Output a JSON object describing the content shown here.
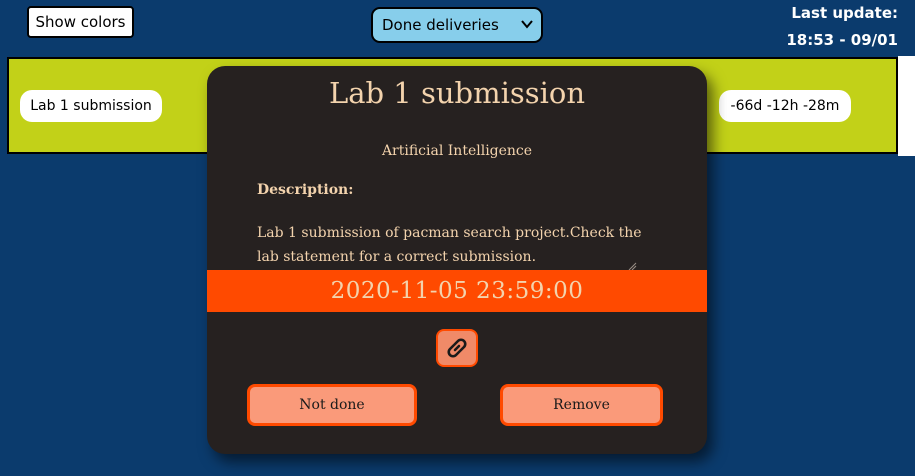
{
  "toolbar": {
    "show_colors_label": "Show colors",
    "filter": {
      "selected": "Done deliveries"
    },
    "last_update_label": "Last update:",
    "last_update_value": "18:53 - 09/01"
  },
  "task": {
    "name": "Lab 1 submission",
    "remaining": "-66d -12h -28m",
    "color": "#c2d118"
  },
  "modal": {
    "title": "Lab 1 submission",
    "subject": "Artificial Intelligence",
    "description_label": "Description:",
    "description": "Lab 1 submission of pacman search project.Check the lab statement for a correct submission.",
    "due_date": "2020-11-05 23:59:00",
    "link_icon": "link-icon",
    "not_done_label": "Not done",
    "remove_label": "Remove",
    "accent_color": "#ff4a00"
  }
}
